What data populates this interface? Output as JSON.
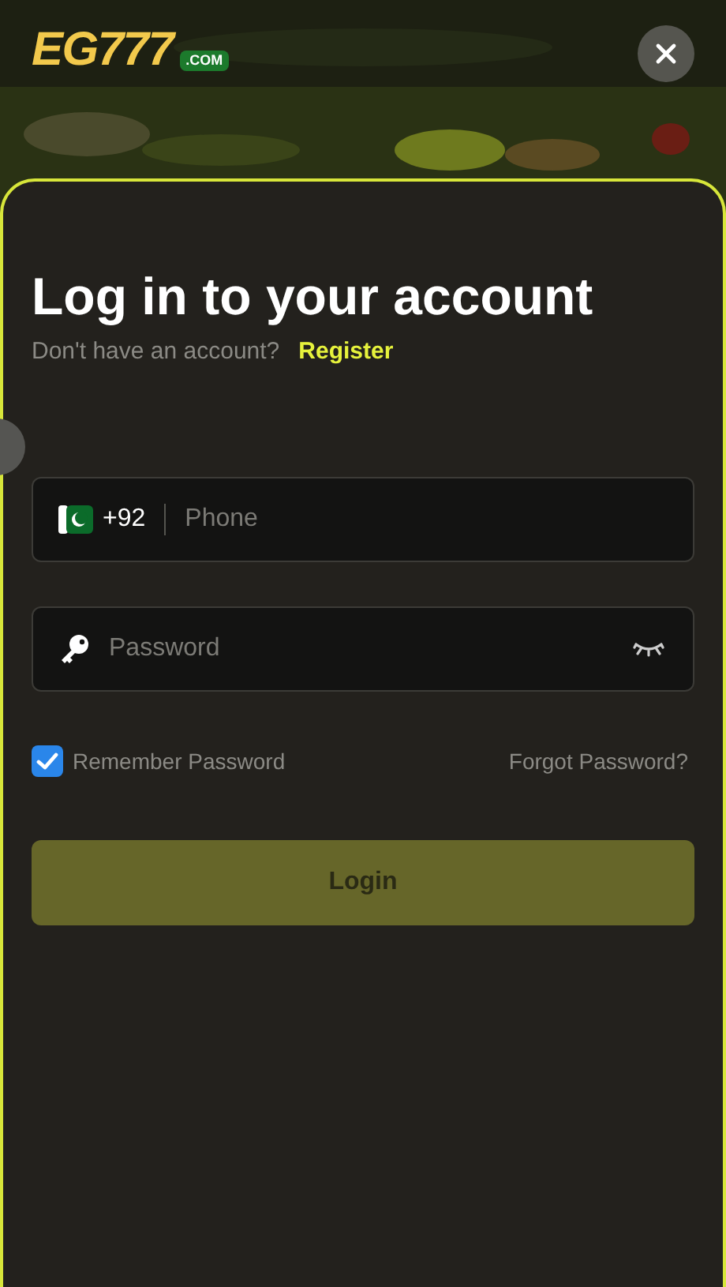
{
  "header": {
    "logo": {
      "text": "EG777",
      "badge": ".COM"
    }
  },
  "login": {
    "title": "Log in to your account",
    "prompt": "Don't have an account?",
    "register_link": "Register",
    "phone": {
      "country_code": "+92",
      "placeholder": "Phone"
    },
    "password": {
      "placeholder": "Password",
      "visible": false
    },
    "remember": {
      "label": "Remember Password",
      "checked": true
    },
    "forgot_link": "Forgot Password?",
    "submit": {
      "label": "Login",
      "disabled": true
    }
  }
}
